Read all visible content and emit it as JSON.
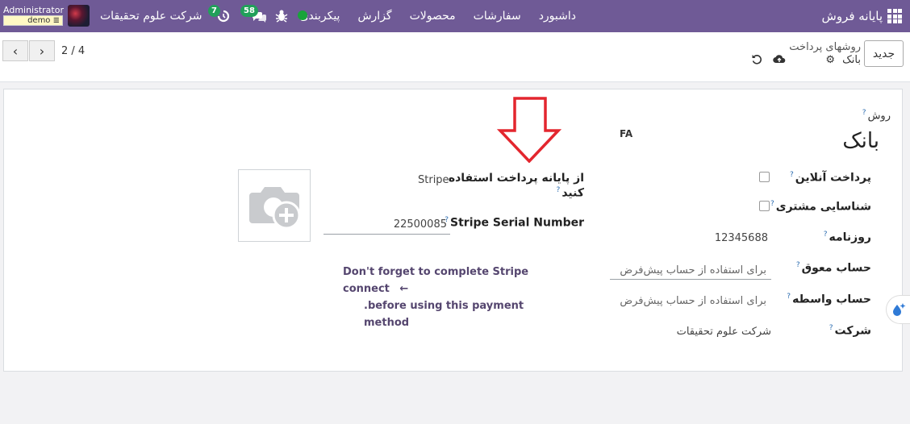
{
  "navbar": {
    "brand": "پایانه فروش",
    "menu": [
      "داشبورد",
      "سفارشات",
      "محصولات",
      "گزارش",
      "پیکربندی"
    ],
    "company": "شرکت علوم تحقیقات",
    "user": "Administrator",
    "db": "demo",
    "messages_count": "58",
    "activities_count": "7",
    "accent": "#6f5a96"
  },
  "control": {
    "new_label": "جدید",
    "breadcrumb_parent": "روشهای پرداخت",
    "breadcrumb_current": "بانک",
    "pager": "2 / 4"
  },
  "form": {
    "method_label": "روش",
    "method_value": "بانک",
    "lang": "FA",
    "online_payment_label": "پرداخت آنلاین",
    "customer_id_label": "شناسایی مشتری",
    "journal_label": "روزنامه",
    "journal_value": "12345688",
    "outstanding_label": "حساب معوق",
    "outstanding_placeholder": "برای استفاده از حساب پیش‌فرض",
    "intermediary_label": "حساب واسطه",
    "intermediary_placeholder": "برای استفاده از حساب پیش‌فرض",
    "company_label": "شرکت",
    "company_value": "شرکت علوم تحقیقات",
    "terminal_label_line1": "از پایانه پرداخت استفاده",
    "terminal_label_line2": "کنید",
    "terminal_value": "Stripe",
    "serial_label": "Stripe Serial Number",
    "serial_value": "22500085",
    "warning_line1": "Don't forget to complete Stripe connect",
    "warning_line2": ".before using this payment method",
    "help_mark": "?"
  }
}
